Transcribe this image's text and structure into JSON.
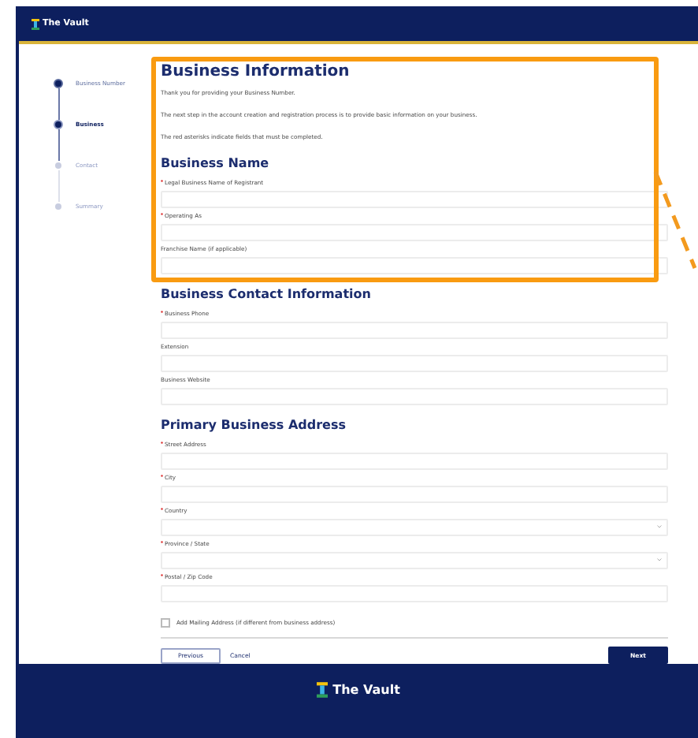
{
  "header": {
    "brand": "The Vault"
  },
  "steps": [
    {
      "label": "Business Number",
      "completed": true,
      "selected": false
    },
    {
      "label": "Business",
      "completed": false,
      "selected": true
    },
    {
      "label": "Contact",
      "completed": false,
      "selected": false
    },
    {
      "label": "Summary",
      "completed": false,
      "selected": false
    }
  ],
  "intro": {
    "title": "Business Information",
    "paragraphs": [
      "Thank you for providing your Business Number.",
      "The next step in the account creation and registration process is to provide basic information on your business.",
      "The red asterisks indicate fields that must be completed."
    ]
  },
  "sections": [
    {
      "heading": "Business Name",
      "fields": [
        {
          "label": "Legal Business Name of Registrant",
          "required": true,
          "kind": "text"
        },
        {
          "label": "Operating As",
          "required": true,
          "kind": "text"
        },
        {
          "label": "Franchise Name (if applicable)",
          "required": false,
          "kind": "text"
        }
      ]
    },
    {
      "heading": "Business Contact Information",
      "fields": [
        {
          "label": "Business Phone",
          "required": true,
          "kind": "text"
        },
        {
          "label": "Extension",
          "required": false,
          "kind": "text"
        },
        {
          "label": "Business Website",
          "required": false,
          "kind": "text"
        }
      ]
    },
    {
      "heading": "Primary Business Address",
      "fields": [
        {
          "label": "Street Address",
          "required": true,
          "kind": "text"
        },
        {
          "label": "City",
          "required": true,
          "kind": "text"
        },
        {
          "label": "Country",
          "required": true,
          "kind": "select"
        },
        {
          "label": "Province / State",
          "required": true,
          "kind": "select"
        },
        {
          "label": "Postal / Zip Code",
          "required": true,
          "kind": "text"
        }
      ]
    }
  ],
  "mailing_checkbox": {
    "label": "Add Mailing Address (if different from business address)",
    "checked": false
  },
  "buttons": {
    "previous": "Previous",
    "cancel": "Cancel",
    "next": "Next"
  },
  "footer": {
    "brand": "The Vault"
  }
}
